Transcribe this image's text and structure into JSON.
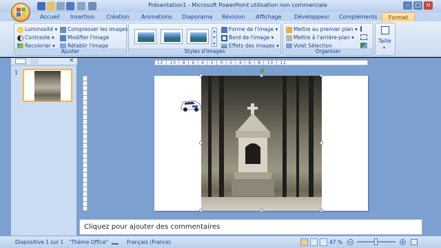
{
  "window": {
    "title": "Présentation1 - Microsoft PowerPoint utilisation non commerciale"
  },
  "tabs": [
    {
      "label": "Accueil"
    },
    {
      "label": "Insertion"
    },
    {
      "label": "Création"
    },
    {
      "label": "Animations"
    },
    {
      "label": "Diaporama"
    },
    {
      "label": "Révision"
    },
    {
      "label": "Affichage"
    },
    {
      "label": "Développeur"
    },
    {
      "label": "Compléments"
    },
    {
      "label": "Format"
    }
  ],
  "ribbon": {
    "ajuster": {
      "label": "Ajuster",
      "luminosite": "Luminosité",
      "contraste": "Contraste",
      "recolorier": "Recolorier",
      "compresser": "Compresser les images",
      "modifier": "Modifier l'image",
      "retablir": "Rétablir l'image"
    },
    "styles": {
      "label": "Styles d'images",
      "forme": "Forme de l'image",
      "bord": "Bord de l'image",
      "effets": "Effets des images"
    },
    "organiser": {
      "label": "Organiser",
      "premier_plan": "Mettre au premier plan",
      "arriere_plan": "Mettre à l'arrière-plan",
      "volet": "Volet Sélection"
    },
    "taille": {
      "label": "Taille"
    }
  },
  "slide_panel": {
    "slide_number": "1"
  },
  "ruler": {
    "top": "·12·|·10·|·8·|·6·|·4·|·2·|·0·|·2·|·4·|·6·|·8·|·10·|·12"
  },
  "notes": {
    "placeholder": "Cliquez pour ajouter des commentaires"
  },
  "status": {
    "slide": "Diapositive 1 sur 1",
    "theme": "\"Thème Office\"",
    "language": "Français (France)",
    "zoom": "47 %"
  },
  "colors": {
    "accent_format_tab": "#ffd47e",
    "workspace": "#7ca0d0",
    "ribbon": "#c9daf1"
  }
}
